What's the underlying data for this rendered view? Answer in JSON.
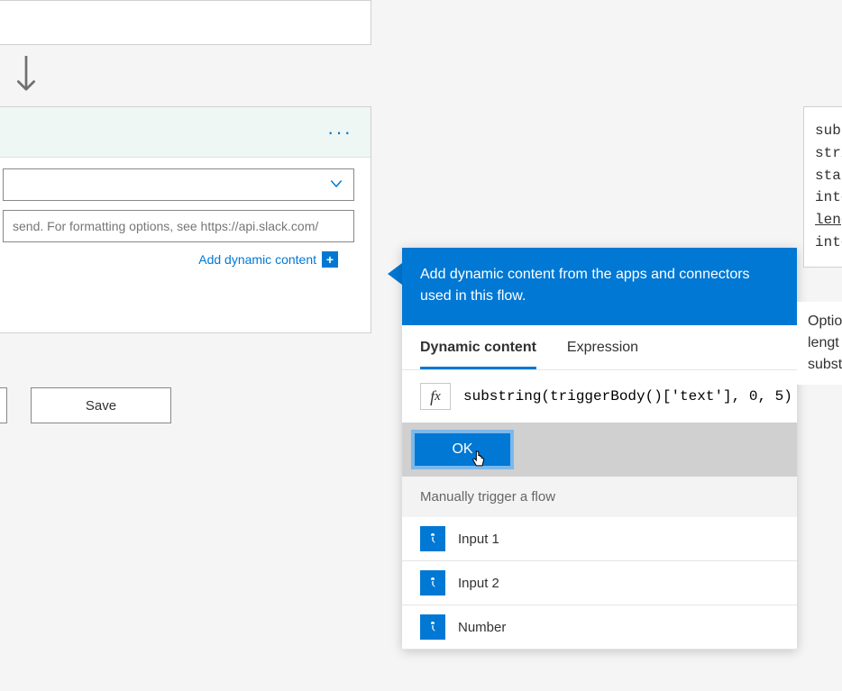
{
  "action": {
    "placeholder": "send. For formatting options, see https://api.slack.com/",
    "add_dynamic_label": "Add dynamic content"
  },
  "buttons": {
    "save": "Save",
    "ok": "OK"
  },
  "dc": {
    "banner": "Add dynamic content from the apps and connectors used in this flow.",
    "tab_dynamic": "Dynamic content",
    "tab_expression": "Expression",
    "expression_value": "substring(triggerBody()['text'], 0, 5)",
    "section_header": "Manually trigger a flow",
    "items": [
      "Input 1",
      "Input 2",
      "Number"
    ]
  },
  "doc_top": {
    "l1": "subs",
    "l2": "stri",
    "l3": "star",
    "l4": "inte",
    "l5": "leng",
    "l6": "inte"
  },
  "doc_bot": {
    "l1": "Optio",
    "l2": "lengt",
    "l3": "subst"
  }
}
